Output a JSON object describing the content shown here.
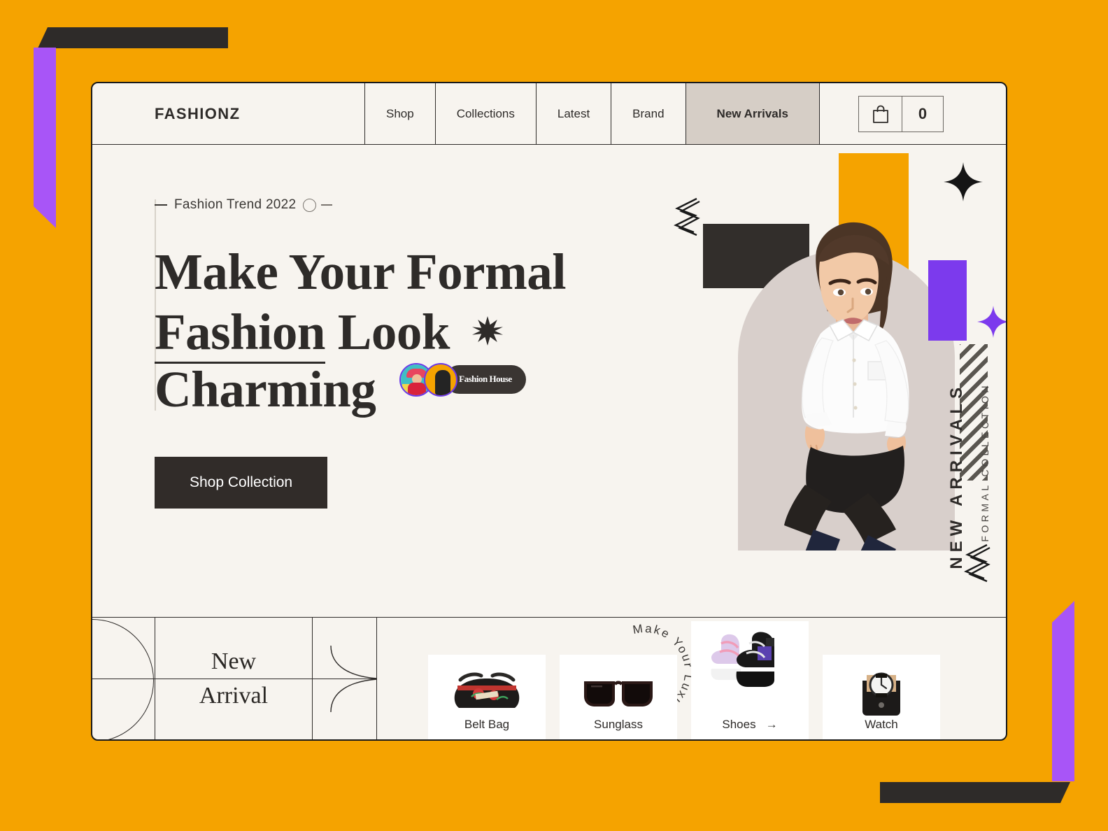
{
  "theme": {
    "background": "#F5A300",
    "card_bg": "#F7F4EF",
    "ink": "#2E2B29",
    "accent_purple": "#7C3AED",
    "active_tab_bg": "#D6CEC6"
  },
  "nav": {
    "brand": "FASHIONZ",
    "items": [
      {
        "label": "Shop",
        "active": false
      },
      {
        "label": "Collections",
        "active": false
      },
      {
        "label": "Latest",
        "active": false
      },
      {
        "label": "Brand",
        "active": false
      },
      {
        "label": "New Arrivals",
        "active": true
      }
    ],
    "cart": {
      "icon": "shopping-bag-icon",
      "count": "0"
    }
  },
  "hero": {
    "eyebrow": "Fashion Trend 2022",
    "headline_line1": "Make Your Formal",
    "headline_line2_underlined": "Fashion",
    "headline_line2_rest": "Look",
    "headline_line3": "Charming",
    "star_icon": "eight-point-star-icon",
    "badge_pill": "Fashion House",
    "cta": "Shop Collection",
    "circle_text": "Make Your Luxury Fass. ",
    "circle_arrow": "↗"
  },
  "side_label": {
    "main": "NEW ARRIVALS",
    "sub": "FORMAL COLLECTION"
  },
  "bottom": {
    "section_title_line1": "New",
    "section_title_line2": "Arrival",
    "products": [
      {
        "name": "Belt Bag",
        "raised": false,
        "arrow": ""
      },
      {
        "name": "Sunglass",
        "raised": false,
        "arrow": ""
      },
      {
        "name": "Shoes",
        "raised": true,
        "arrow": "→"
      },
      {
        "name": "Watch",
        "raised": false,
        "arrow": ""
      }
    ]
  }
}
